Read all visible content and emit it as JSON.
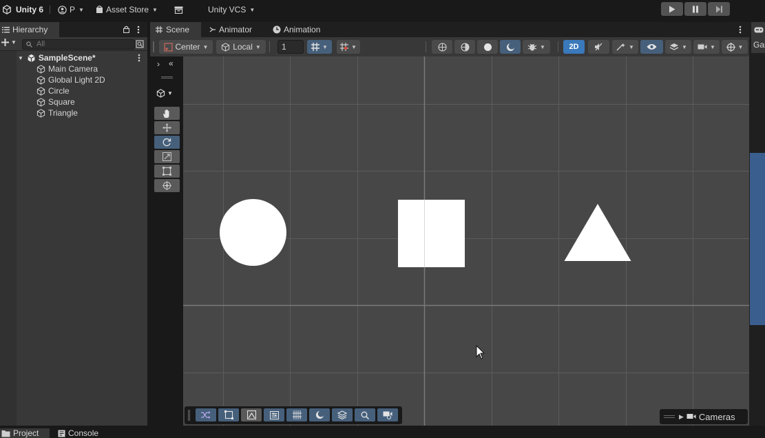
{
  "topbar": {
    "app_title": "Unity 6",
    "account_label": "P",
    "asset_store_label": "Asset Store",
    "vcs_label": "Unity VCS"
  },
  "hierarchy": {
    "tab_label": "Hierarchy",
    "search_placeholder": "All",
    "scene_name": "SampleScene*",
    "items": [
      {
        "label": "Main Camera"
      },
      {
        "label": "Global Light 2D"
      },
      {
        "label": "Circle"
      },
      {
        "label": "Square"
      },
      {
        "label": "Triangle"
      }
    ]
  },
  "scene_view": {
    "tabs": [
      {
        "label": "Scene",
        "icon": "grid-icon",
        "active": true
      },
      {
        "label": "Animator",
        "icon": "animator-icon",
        "active": false
      },
      {
        "label": "Animation",
        "icon": "clock-icon",
        "active": false
      }
    ],
    "toolbar": {
      "pivot_label": "Center",
      "space_label": "Local",
      "snap_value": "1",
      "mode_2d_label": "2D"
    },
    "cameras_overlay_label": "Cameras",
    "shapes": [
      "circle",
      "square",
      "triangle"
    ]
  },
  "game_tab_label": "Gar",
  "bottom_tabs": [
    {
      "label": "Project",
      "active": true
    },
    {
      "label": "Console",
      "active": false
    }
  ],
  "colors": {
    "accent_blue": "#3a79bb",
    "active_tool": "#46607c",
    "viewport_bg": "#474747",
    "grid_line": "#5e5e5e",
    "shape_fill": "#ffffff"
  }
}
